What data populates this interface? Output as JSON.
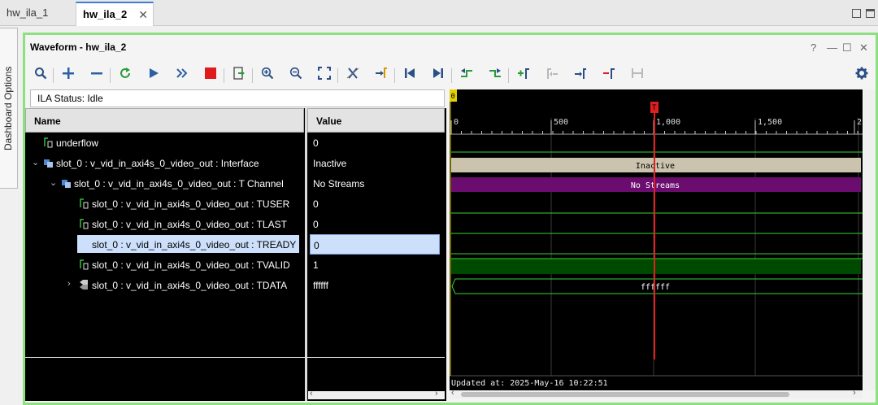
{
  "tabs": [
    {
      "label": "hw_ila_1"
    },
    {
      "label": "hw_ila_2",
      "close": "✕"
    }
  ],
  "side_label": "Dashboard Options",
  "panel": {
    "title": "Waveform - hw_ila_2",
    "help": "?",
    "minimize": "—",
    "maximize": "☐",
    "close": "✕"
  },
  "toolbar_icons": [
    "search-icon",
    "add-icon",
    "remove-icon",
    "refresh-icon",
    "run-icon",
    "run-immediate-icon",
    "stop-icon",
    "export-icon",
    "zoom-in-icon",
    "zoom-out-icon",
    "zoom-fit-icon",
    "cut-icon",
    "go-to-cursor-icon",
    "go-to-start-icon",
    "go-to-end-icon",
    "prev-transition-icon",
    "next-transition-icon",
    "add-marker-icon",
    "prev-marker-icon",
    "next-marker-icon",
    "delete-marker-icon",
    "swap-cursor-icon",
    "settings-icon"
  ],
  "status": {
    "label": "ILA Status:",
    "value": "Idle"
  },
  "columns": {
    "name": "Name",
    "value": "Value"
  },
  "signals": [
    {
      "name": "underflow",
      "value": "0",
      "kind": "bit",
      "indent": 0
    },
    {
      "name": "slot_0 : v_vid_in_axi4s_0_video_out : Interface",
      "value": "Inactive",
      "kind": "group",
      "indent": 0,
      "expanded": true
    },
    {
      "name": "slot_0 : v_vid_in_axi4s_0_video_out : T Channel",
      "value": "No Streams",
      "kind": "group",
      "indent": 1,
      "expanded": true
    },
    {
      "name": "slot_0 : v_vid_in_axi4s_0_video_out : TUSER",
      "value": "0",
      "kind": "bit",
      "indent": 2
    },
    {
      "name": "slot_0 : v_vid_in_axi4s_0_video_out : TLAST",
      "value": "0",
      "kind": "bit",
      "indent": 2
    },
    {
      "name": "slot_0 : v_vid_in_axi4s_0_video_out : TREADY",
      "value": "0",
      "kind": "bit",
      "indent": 2,
      "selected": true
    },
    {
      "name": "slot_0 : v_vid_in_axi4s_0_video_out : TVALID",
      "value": "1",
      "kind": "bit",
      "indent": 2
    },
    {
      "name": "slot_0 : v_vid_in_axi4s_0_video_out : TDATA",
      "value": "ffffff",
      "kind": "bus",
      "indent": 2,
      "expanded": false
    }
  ],
  "waveform": {
    "marker_zero": "0",
    "trigger_marker": "T",
    "ticks": [
      "0",
      "500",
      "1,000",
      "1,500",
      "2,"
    ],
    "bars": [
      {
        "label": "Inactive",
        "color": "#cbc3ae"
      },
      {
        "label": "No Streams",
        "color": "#6a0d6f"
      },
      {
        "label": "ffffff",
        "color": "#000000"
      }
    ],
    "updated_at": "Updated at: 2025-May-16 10:22:51",
    "colors": {
      "grid": "#3a3a3a",
      "signal": "#35d435",
      "cursor": "#e02020",
      "high_fill": "#004a00"
    }
  }
}
